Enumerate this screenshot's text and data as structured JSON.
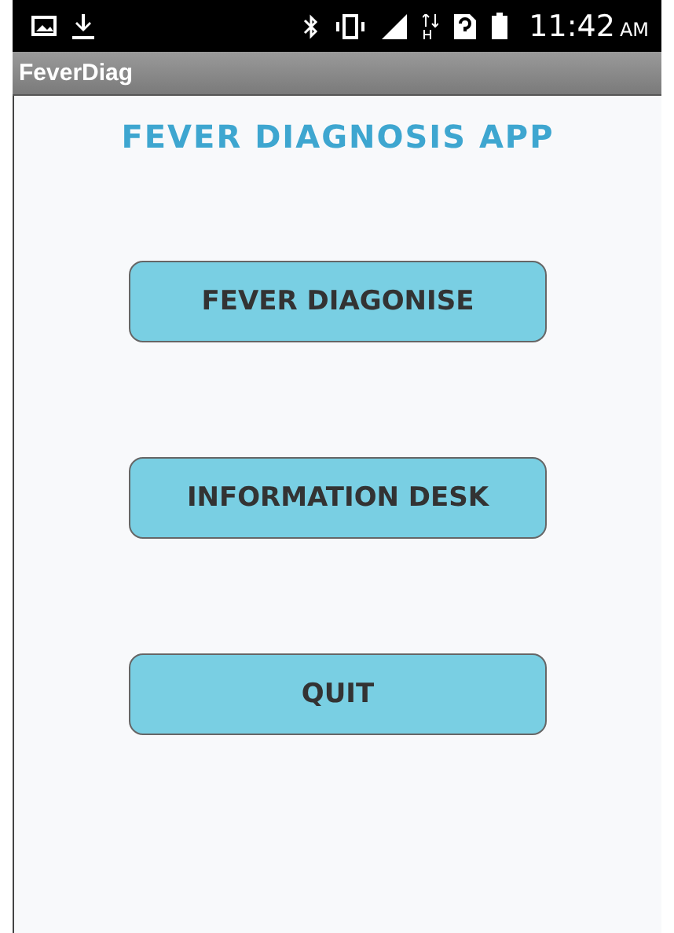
{
  "status_bar": {
    "time": "11:42",
    "period": "AM"
  },
  "action_bar": {
    "title": "FeverDiag"
  },
  "heading": "FEVER DIAGNOSIS APP",
  "buttons": [
    {
      "label": "FEVER DIAGONISE"
    },
    {
      "label": "INFORMATION DESK"
    },
    {
      "label": "QUIT"
    }
  ]
}
